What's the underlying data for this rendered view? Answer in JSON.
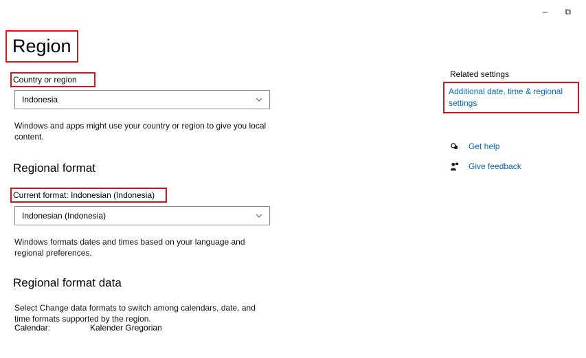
{
  "window": {
    "minimize_glyph": "–",
    "restore_glyph": "⧉"
  },
  "page": {
    "title": "Region"
  },
  "country": {
    "label": "Country or region",
    "value": "Indonesia",
    "description": "Windows and apps might use your country or region to give you local content."
  },
  "regional_format": {
    "title": "Regional format",
    "current_label": "Current format: Indonesian (Indonesia)",
    "value": "Indonesian (Indonesia)",
    "description": "Windows formats dates and times based on your language and regional preferences."
  },
  "regional_format_data": {
    "title": "Regional format data",
    "description": "Select Change data formats to switch among calendars, date, and time formats supported by the region.",
    "calendar_label": "Calendar:",
    "calendar_value": "Kalender Gregorian"
  },
  "related": {
    "heading": "Related settings",
    "link": "Additional date, time & regional settings"
  },
  "help": {
    "get_help": "Get help",
    "give_feedback": "Give feedback"
  },
  "colors": {
    "link": "#0067c0",
    "highlight": "#e01010"
  },
  "icons": [
    "minimize-icon",
    "restore-icon",
    "chevron-down-icon",
    "help-chat-icon",
    "feedback-icon"
  ]
}
